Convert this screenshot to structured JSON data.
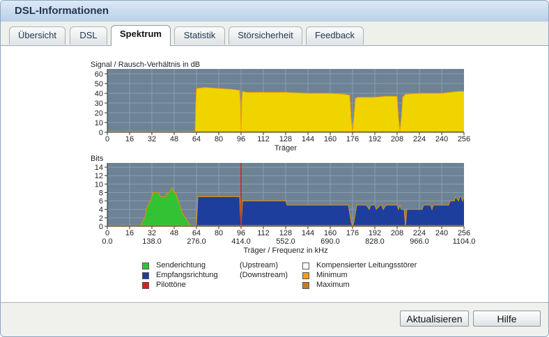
{
  "window": {
    "title": "DSL-Informationen"
  },
  "tabs": [
    {
      "label": "Übersicht",
      "active": false
    },
    {
      "label": "DSL",
      "active": false
    },
    {
      "label": "Spektrum",
      "active": true
    },
    {
      "label": "Statistik",
      "active": false
    },
    {
      "label": "Störsicherheit",
      "active": false
    },
    {
      "label": "Feedback",
      "active": false
    }
  ],
  "colors": {
    "plot_bg": "#6e8296",
    "grid": "#8a9db0",
    "snr_fill": "#f0d400",
    "snr_line": "#e8a000",
    "upstream": "#33c233",
    "downstream": "#1e3e9e",
    "pilot": "#d42020",
    "outline": "#e89000"
  },
  "chart_data": [
    {
      "type": "area",
      "title": "Signal / Rausch-Verhältnis in dB",
      "xlabel": "Träger",
      "ylabel": "",
      "xlim": [
        0,
        256
      ],
      "ylim": [
        0,
        65
      ],
      "x_ticks": [
        "0",
        "16",
        "32",
        "48",
        "64",
        "80",
        "96",
        "112",
        "128",
        "144",
        "160",
        "176",
        "192",
        "208",
        "224",
        "240",
        "256"
      ],
      "y_ticks": [
        "0",
        "10",
        "20",
        "30",
        "40",
        "50",
        "60"
      ],
      "grid": true,
      "series": [
        {
          "x": [
            0,
            63,
            63.5,
            64,
            70,
            80,
            90,
            95,
            95.5,
            96,
            96.5,
            97,
            100,
            112,
            128,
            144,
            160,
            170,
            174,
            175,
            176,
            177,
            178,
            180,
            192,
            200,
            208,
            209,
            210,
            211,
            212,
            214,
            224,
            240,
            252,
            256
          ],
          "y": [
            1,
            1,
            30,
            45,
            46,
            45,
            44,
            43,
            30,
            1,
            30,
            42,
            41,
            41,
            41,
            40,
            40,
            39,
            38,
            15,
            1,
            15,
            35,
            36,
            36,
            37,
            37,
            15,
            1,
            15,
            36,
            39,
            40,
            40,
            42,
            42
          ]
        }
      ]
    },
    {
      "type": "area",
      "title": "Bits",
      "xlabel": "Träger / Frequenz in kHz",
      "ylabel": "",
      "xlim": [
        0,
        256
      ],
      "ylim": [
        0,
        15
      ],
      "x_ticks": [
        "0",
        "16",
        "32",
        "48",
        "64",
        "80",
        "96",
        "112",
        "128",
        "144",
        "160",
        "176",
        "192",
        "208",
        "224",
        "240",
        "256"
      ],
      "x_ticks_secondary": [
        "0.0",
        "138.0",
        "276.0",
        "414.0",
        "552.0",
        "690.0",
        "828.0",
        "966.0",
        "1104.0"
      ],
      "y_ticks": [
        "0",
        "2",
        "4",
        "6",
        "8",
        "10",
        "12",
        "14"
      ],
      "grid": true,
      "series": [
        {
          "name": "Senderichtung",
          "x": [
            24,
            25,
            27,
            28,
            29,
            31,
            32,
            33,
            35,
            37,
            38,
            39,
            40,
            41,
            42,
            43,
            44,
            45,
            46,
            47,
            48,
            49,
            50,
            51,
            52,
            53,
            54,
            56,
            58,
            60,
            61,
            62
          ],
          "y": [
            0,
            1,
            2,
            4,
            5,
            6,
            7,
            8,
            8,
            8,
            7,
            7,
            7,
            7,
            7,
            8,
            8,
            8,
            9,
            9,
            8,
            8,
            7,
            6,
            5,
            4,
            3,
            2,
            1,
            0,
            0,
            0
          ]
        },
        {
          "name": "Empfangsrichtung",
          "x": [
            64,
            65,
            66,
            95,
            95.5,
            96,
            96.5,
            97,
            100,
            128,
            129,
            130,
            160,
            170,
            172,
            173,
            174,
            175,
            176,
            177,
            178,
            179,
            180,
            186,
            188,
            189,
            190,
            192,
            193,
            196,
            197,
            198,
            200,
            201,
            202,
            208,
            209,
            210,
            211,
            212,
            213,
            214,
            215,
            224,
            226,
            227,
            228,
            232,
            233,
            234,
            236,
            240,
            245,
            246,
            248,
            249,
            250,
            252,
            253,
            254,
            255,
            256
          ],
          "y": [
            0,
            7,
            7,
            7,
            3,
            0,
            3,
            6,
            6,
            6,
            5,
            5,
            5,
            5,
            5,
            5,
            3,
            1,
            0,
            1,
            3,
            5,
            5,
            5,
            4,
            5,
            5,
            5,
            4,
            5,
            5,
            4,
            5,
            5,
            5,
            5,
            4,
            5,
            4,
            4,
            4,
            0,
            4,
            4,
            4,
            5,
            5,
            5,
            4,
            5,
            5,
            5,
            5,
            6,
            6,
            6,
            7,
            6,
            7,
            7,
            6,
            7
          ]
        },
        {
          "name": "Pilottöne",
          "x": [
            96
          ],
          "y": [
            15
          ]
        }
      ]
    }
  ],
  "legend": {
    "left": [
      {
        "label": "Senderichtung",
        "note": "(Upstream)",
        "color": "#33c233"
      },
      {
        "label": "Empfangsrichtung",
        "note": "(Downstream)",
        "color": "#1e3e9e"
      },
      {
        "label": "Pilottöne",
        "note": "",
        "color": "#d42020"
      }
    ],
    "right": [
      {
        "label": "Kompensierter Leitungsstörer",
        "color": "#ffffff"
      },
      {
        "label": "Minimum",
        "color": "#f39c1c"
      },
      {
        "label": "Maximum",
        "color": "#c97a25"
      }
    ]
  },
  "buttons": {
    "refresh": "Aktualisieren",
    "help": "Hilfe"
  }
}
